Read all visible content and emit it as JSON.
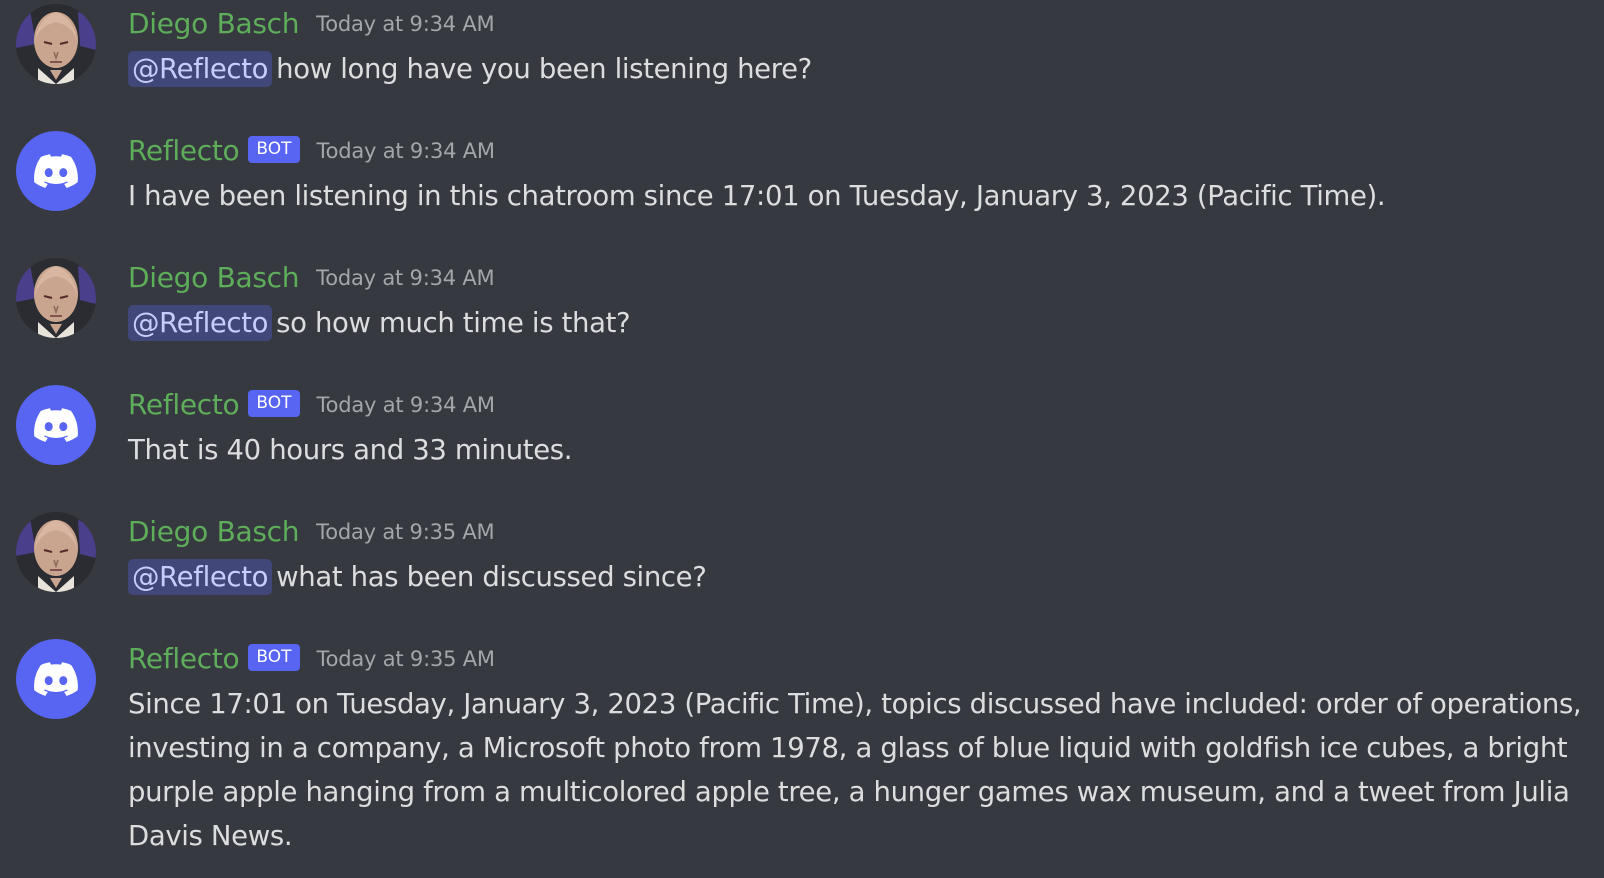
{
  "messages": [
    {
      "author": "Diego Basch",
      "is_bot": false,
      "timestamp": "Today at 9:34 AM",
      "mention": "@Reflecto",
      "text": "how long have you been listening here?"
    },
    {
      "author": "Reflecto",
      "is_bot": true,
      "bot_tag": "BOT",
      "timestamp": "Today at 9:34 AM",
      "mention": "",
      "text": "I have been listening in this chatroom since 17:01 on Tuesday, January 3, 2023 (Pacific Time)."
    },
    {
      "author": "Diego Basch",
      "is_bot": false,
      "timestamp": "Today at 9:34 AM",
      "mention": "@Reflecto",
      "text": "so how much time is that?"
    },
    {
      "author": "Reflecto",
      "is_bot": true,
      "bot_tag": "BOT",
      "timestamp": "Today at 9:34 AM",
      "mention": "",
      "text": "That is 40 hours and 33 minutes."
    },
    {
      "author": "Diego Basch",
      "is_bot": false,
      "timestamp": "Today at 9:35 AM",
      "mention": "@Reflecto",
      "text": "what has been discussed since?"
    },
    {
      "author": "Reflecto",
      "is_bot": true,
      "bot_tag": "BOT",
      "timestamp": "Today at 9:35 AM",
      "mention": "",
      "text": "Since 17:01 on Tuesday, January 3, 2023 (Pacific Time), topics discussed have included: order of operations, investing in a company, a Microsoft photo from 1978, a glass of blue liquid with goldfish ice cubes, a bright purple apple hanging from a multicolored apple tree, a hunger games wax museum, and a tweet from Julia Davis News."
    }
  ],
  "icons": {
    "bot_avatar": "discord-logo-icon",
    "user_avatar": "user-avatar-bald-anime-character"
  },
  "colors": {
    "background": "#36393f",
    "username": "#5ead5a",
    "bot_tag": "#5865f2",
    "mention_bg": "#414779",
    "mention_text": "#c9cdfb",
    "timestamp": "#a3a6aa",
    "message_text": "#dcddde"
  }
}
